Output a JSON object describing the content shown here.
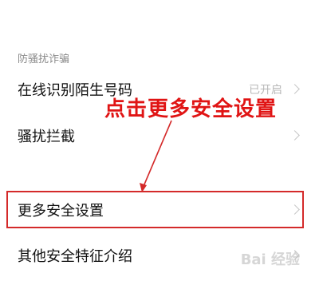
{
  "section": {
    "title": "防骚扰诈骗"
  },
  "rows": [
    {
      "label": "在线识别陌生号码",
      "value": "已开启"
    },
    {
      "label": "骚扰拦截",
      "value": ""
    },
    {
      "label": "更多安全设置",
      "value": ""
    },
    {
      "label": "其他安全特征介绍",
      "value": ""
    }
  ],
  "annotation": {
    "text": "点击更多安全设置"
  },
  "watermark": {
    "text": "Bai 经验"
  },
  "colors": {
    "annotation": "#e01414",
    "highlight_border": "#d42a2a",
    "secondary_text": "#b8b8b8"
  }
}
